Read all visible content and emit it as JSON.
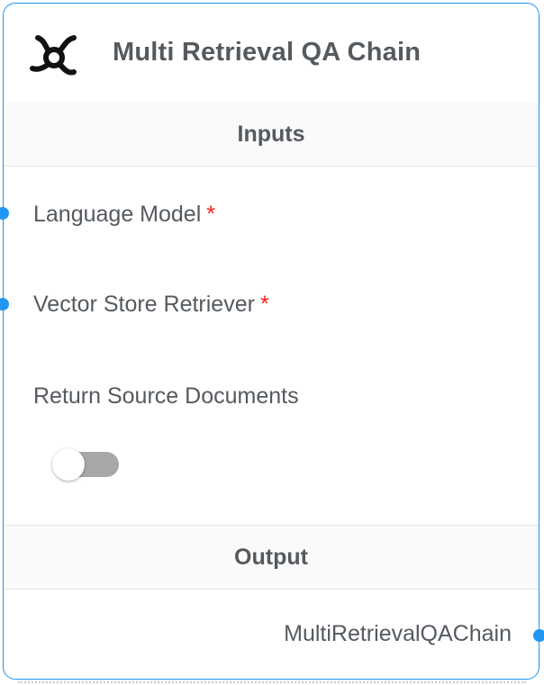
{
  "node": {
    "title": "Multi Retrieval QA Chain",
    "icon": "chain-link-icon",
    "accent_color": "#2196f3"
  },
  "inputs": {
    "section_label": "Inputs",
    "params": [
      {
        "label": "Language Model",
        "required_marker": "*"
      },
      {
        "label": "Vector Store Retriever",
        "required_marker": "*"
      },
      {
        "label": "Return Source Documents",
        "toggle_on": false
      }
    ]
  },
  "output": {
    "section_label": "Output",
    "label": "MultiRetrievalQAChain"
  },
  "colors": {
    "required": "#ff1a1a",
    "text": "#555a5f",
    "toggle_track_off": "#a8a8a8"
  }
}
